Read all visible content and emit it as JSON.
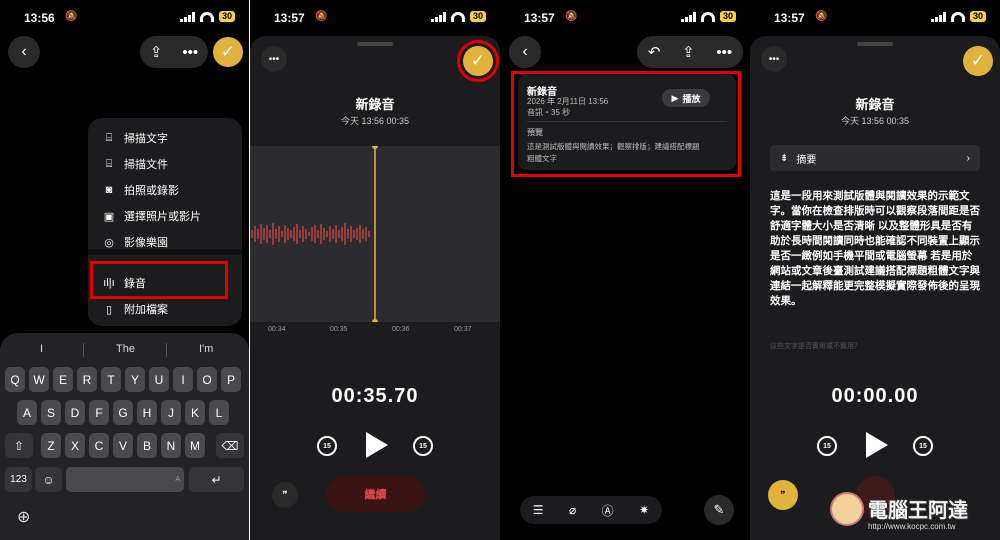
{
  "panel1": {
    "status": {
      "time": "13:56",
      "battery": "30"
    },
    "menu_items": [
      {
        "icon": "scan-text-icon",
        "label": "掃描文字"
      },
      {
        "icon": "scan-doc-icon",
        "label": "掃描文件"
      },
      {
        "icon": "camera-icon",
        "label": "拍照或錄影"
      },
      {
        "icon": "photo-icon",
        "label": "選擇照片或影片"
      },
      {
        "icon": "playground-icon",
        "label": "影像樂園"
      },
      {
        "icon": "waveform-icon",
        "label": "錄音"
      },
      {
        "icon": "attachment-icon",
        "label": "附加檔案"
      }
    ],
    "suggestions": [
      "I",
      "The",
      "I'm"
    ],
    "keys": {
      "row1": [
        "Q",
        "W",
        "E",
        "R",
        "T",
        "Y",
        "U",
        "I",
        "O",
        "P"
      ],
      "row2": [
        "A",
        "S",
        "D",
        "F",
        "G",
        "H",
        "J",
        "K",
        "L"
      ],
      "row3": [
        "Z",
        "X",
        "C",
        "V",
        "B",
        "N",
        "M"
      ],
      "num": "123",
      "emoji": "☺",
      "space_hint": "A",
      "return": "↵",
      "delete": "⌫",
      "shift": "⇧",
      "globe": "⊕"
    }
  },
  "panel2": {
    "status": {
      "time": "13:57",
      "battery": "30"
    },
    "title": "新錄音",
    "subtitle": "今天 13:56  00:35",
    "ticks": [
      "00:34",
      "00:35",
      "00:36",
      "00:37"
    ],
    "elapsed": "00:35.70",
    "skip_back": "15",
    "skip_fwd": "15",
    "continue_label": "繼續"
  },
  "panel3": {
    "status": {
      "time": "13:57",
      "battery": "30"
    },
    "card": {
      "title": "新錄音",
      "date": "2026 年 2月11日 13:56",
      "meta": "音訊・35 秒",
      "play_label": "播放",
      "preview_label": "預覽",
      "preview_text_line1": "這是測試版體與閱讀效果；觀察排版；建議搭配標題",
      "preview_text_line2": "粗體文字"
    }
  },
  "panel4": {
    "status": {
      "time": "13:57",
      "battery": "30"
    },
    "title": "新錄音",
    "subtitle": "今天 13:56  00:35",
    "summary_label": "摘要",
    "body": "這是一段用來測試版體與閱讀效果的示範文字。當你在檢查排版時可以觀察段落間距是否舒適字體大小是否清晰 以及整體形具是否有助於長時間閱讀同時也能確認不同裝置上顯示是否一緻例如手機平間或電腦螢幕 若是用於網站或文章後臺測試建議搭配標題粗體文字與連結一起解釋能更完整模擬實際發佈後的呈現效果。",
    "faded_text": "這些文字是否實用或不實用？",
    "elapsed": "00:00.00",
    "skip_back": "15",
    "skip_fwd": "15"
  },
  "watermark": {
    "line1": "電腦王阿達",
    "line2": "http://www.kocpc.com.tw"
  },
  "colors": {
    "accent_yellow": "#e2b33c",
    "highlight_red": "#e00000",
    "continue_red": "#e0484a"
  }
}
